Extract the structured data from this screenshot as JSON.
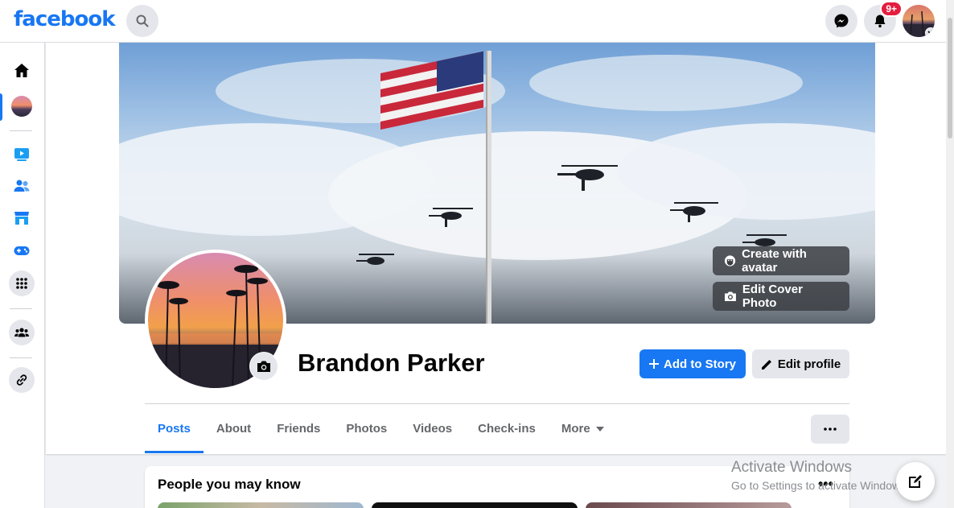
{
  "app": {
    "logo": "facebook"
  },
  "header": {
    "notification_count": "9+",
    "icons": [
      "search-icon",
      "messenger-icon",
      "bell-icon",
      "account-avatar"
    ]
  },
  "rail": {
    "items": [
      "home-icon",
      "profile-avatar",
      "watch-icon",
      "friends-icon",
      "marketplace-icon",
      "gaming-icon",
      "menu-grid-icon",
      "groups-icon",
      "link-icon"
    ]
  },
  "cover": {
    "create_avatar_label": "Create with avatar",
    "edit_cover_label": "Edit Cover Photo"
  },
  "profile": {
    "name": "Brandon Parker",
    "add_story_label": "Add to Story",
    "edit_profile_label": "Edit profile"
  },
  "tabs": [
    {
      "label": "Posts",
      "active": true
    },
    {
      "label": "About"
    },
    {
      "label": "Friends"
    },
    {
      "label": "Photos"
    },
    {
      "label": "Videos"
    },
    {
      "label": "Check-ins"
    },
    {
      "label": "More"
    }
  ],
  "pymk": {
    "title": "People you may know",
    "more": "•••"
  },
  "watermark": {
    "line1": "Activate Windows",
    "line2": "Go to Settings to activate Windows."
  },
  "colors": {
    "brand": "#1877f2",
    "badge": "#e41e3f"
  }
}
